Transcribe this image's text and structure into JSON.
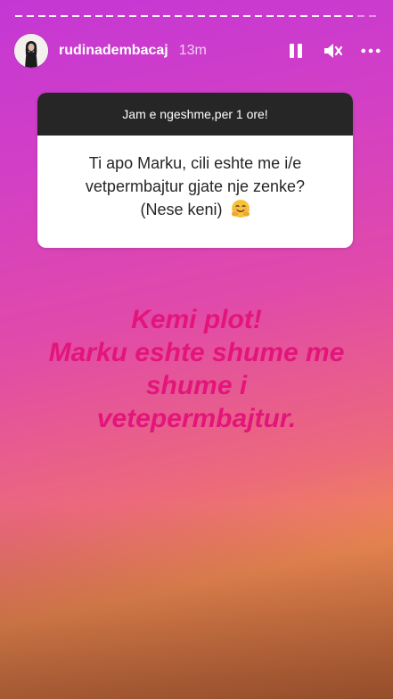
{
  "story": {
    "user": {
      "username": "rudinadembacaj",
      "time_ago": "13m"
    },
    "progress": {
      "segments_total": 32,
      "segments_viewed": 30
    },
    "controls": {
      "pause_icon": "pause-icon",
      "mute_icon": "mute-icon",
      "more_icon": "more-options-icon"
    },
    "question_card": {
      "prompt": "Jam e ngeshme,per 1 ore!",
      "question_lines": [
        "Ti apo Marku, cili eshte me i/e",
        "vetpermbajtur gjate nje zenke?",
        "(Nese keni)"
      ],
      "emoji": "smiling-face-with-hands-emoji"
    },
    "answer": {
      "color": "#e3157a",
      "lines": [
        "Kemi plot!",
        "Marku eshte shume me",
        "shume i",
        "vetepermbajtur."
      ]
    }
  }
}
